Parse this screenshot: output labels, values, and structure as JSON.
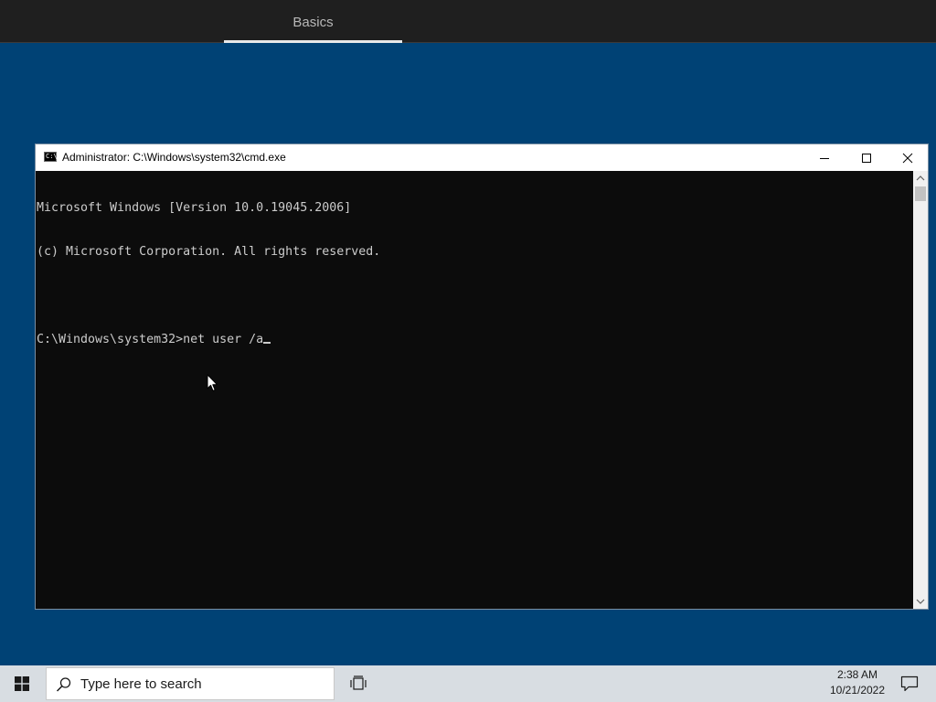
{
  "oobe": {
    "tab_label": "Basics"
  },
  "cmd": {
    "title": "Administrator: C:\\Windows\\system32\\cmd.exe",
    "icon_label": "C:\\",
    "lines": [
      "Microsoft Windows [Version 10.0.19045.2006]",
      "(c) Microsoft Corporation. All rights reserved.",
      "",
      "C:\\Windows\\system32>net user /a"
    ]
  },
  "taskbar": {
    "search_placeholder": "Type here to search",
    "time": "2:38 AM",
    "date": "10/21/2022"
  },
  "colors": {
    "desktop": "#004275",
    "top_bar": "#1f1f1f",
    "console_bg": "#0c0c0c",
    "console_text": "#cccccc",
    "taskbar": "#d8dde2"
  },
  "icons": {
    "start": "windows-logo-icon",
    "search": "search-icon",
    "task_view": "task-view-icon",
    "notifications": "notification-icon",
    "minimize": "minimize-icon",
    "maximize": "maximize-icon",
    "close": "close-icon"
  }
}
